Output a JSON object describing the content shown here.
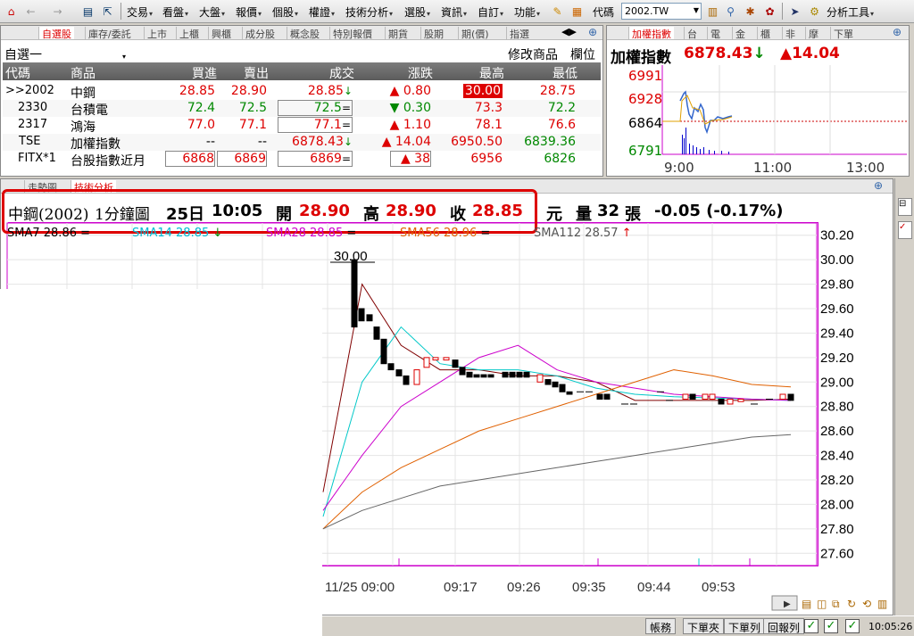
{
  "toolbar": {
    "menus": [
      "交易",
      "看盤",
      "大盤",
      "報價",
      "個股",
      "權證",
      "技術分析",
      "選股",
      "資訊",
      "自訂",
      "功能"
    ],
    "code_label": "代碼",
    "code_value": "2002.TW",
    "tools_label": "分析工具"
  },
  "watchlist": {
    "tabs": [
      "自選股",
      "庫存/委託",
      "上市",
      "上櫃",
      "興櫃",
      "成分股",
      "概念股",
      "特別報價",
      "期貨",
      "股期",
      "期(價)",
      "指選"
    ],
    "group_name": "自選一",
    "edit_label": "修改商品",
    "field_label": "欄位",
    "columns": [
      "代碼",
      "商品",
      "買進",
      "賣出",
      "成交",
      "漲跌",
      "最高",
      "最低"
    ],
    "rows": [
      {
        "code": ">>2002",
        "name": "中鋼",
        "bid": "28.85",
        "ask": "28.90",
        "last": "28.85",
        "last_mark": "↓",
        "chg": "0.80",
        "chg_dir": "▲",
        "high": "30.00",
        "low": "28.75"
      },
      {
        "code": "2330",
        "name": "台積電",
        "bid": "72.4",
        "ask": "72.5",
        "last": "72.5",
        "last_mark": "=",
        "chg": "0.30",
        "chg_dir": "▼",
        "high": "73.3",
        "low": "72.2"
      },
      {
        "code": "2317",
        "name": "鴻海",
        "bid": "77.0",
        "ask": "77.1",
        "last": "77.1",
        "last_mark": "=",
        "chg": "1.10",
        "chg_dir": "▲",
        "high": "78.1",
        "low": "76.6"
      },
      {
        "code": "TSE",
        "name": "加權指數",
        "bid": "--",
        "ask": "--",
        "last": "6878.43",
        "last_mark": "↓",
        "chg": "14.04",
        "chg_dir": "▲",
        "high": "6950.50",
        "low": "6839.36"
      },
      {
        "code": "FITX*1",
        "name": "台股指數近月",
        "bid": "6868",
        "ask": "6869",
        "last": "6869",
        "last_mark": "=",
        "chg": "38",
        "chg_dir": "▲",
        "high": "6956",
        "low": "6826"
      }
    ]
  },
  "index_panel": {
    "tabs": [
      "加權指數",
      "台",
      "電",
      "金",
      "櫃",
      "非",
      "摩",
      "下單"
    ],
    "title": "加權指數",
    "value": "6878.43",
    "value_mark": "↓",
    "change": "▲14.04",
    "y_labels": [
      "6991",
      "6928",
      "6864",
      "6791"
    ],
    "x_labels": [
      "9:00",
      "11:00",
      "13:00"
    ]
  },
  "chart": {
    "tabs": [
      "走勢圖",
      "技術分析"
    ],
    "info": {
      "name": "中鋼(2002)",
      "period": "1分鐘圖",
      "date": "25日",
      "time": "10:05",
      "open_label": "開",
      "open": "28.90",
      "high_label": "高",
      "high": "28.90",
      "close_label": "收",
      "close": "28.85",
      "unit": "元",
      "vol_label": "量",
      "volume": "32",
      "vol_unit": "張",
      "change": "-0.05 (-0.17%)"
    },
    "smas": [
      {
        "label": "SMA7 28.86",
        "mark": "=",
        "color": "#000000"
      },
      {
        "label": "SMA14 28.85",
        "mark": "↓",
        "color": "#00bcd4"
      },
      {
        "label": "SMA28 28.85",
        "mark": "=",
        "color": "#cc00cc"
      },
      {
        "label": "SMA56 28.96",
        "mark": "=",
        "color": "#e06000"
      },
      {
        "label": "SMA112 28.57",
        "mark": "↑",
        "color": "#555555"
      }
    ],
    "peak_label": "30.00",
    "y_labels": [
      "30.20",
      "30.00",
      "29.80",
      "29.60",
      "29.40",
      "29.20",
      "29.00",
      "28.80",
      "28.60",
      "28.40",
      "28.20",
      "28.00",
      "27.80",
      "27.60"
    ],
    "x_labels": [
      "11/25 09:00",
      "09:17",
      "09:26",
      "09:35",
      "09:44",
      "09:53"
    ]
  },
  "chart_data": {
    "type": "line",
    "title": "中鋼(2002) 1分鐘圖",
    "xlabel": "",
    "ylabel": "",
    "ylim": [
      27.5,
      30.3
    ],
    "x_ticks": [
      "11/25 09:00",
      "09:17",
      "09:26",
      "09:35",
      "09:44",
      "09:53"
    ],
    "series": [
      {
        "name": "SMA7",
        "values": [
          28.1,
          29.8,
          29.3,
          29.1,
          29.1,
          29.05,
          29.05,
          29.0,
          28.85,
          28.85,
          28.85,
          28.85,
          28.86
        ]
      },
      {
        "name": "SMA14",
        "values": [
          27.9,
          29.0,
          29.45,
          29.15,
          29.1,
          29.1,
          29.05,
          28.95,
          28.9,
          28.88,
          28.87,
          28.86,
          28.85
        ]
      },
      {
        "name": "SMA28",
        "values": [
          27.95,
          28.4,
          28.8,
          29.0,
          29.2,
          29.3,
          29.1,
          29.0,
          28.95,
          28.9,
          28.88,
          28.86,
          28.85
        ]
      },
      {
        "name": "SMA56",
        "values": [
          27.8,
          28.1,
          28.3,
          28.45,
          28.6,
          28.7,
          28.8,
          28.9,
          29.0,
          29.1,
          29.05,
          28.98,
          28.96
        ]
      },
      {
        "name": "SMA112",
        "values": [
          27.8,
          27.95,
          28.05,
          28.15,
          28.2,
          28.25,
          28.3,
          28.35,
          28.4,
          28.45,
          28.5,
          28.55,
          28.57
        ]
      }
    ]
  },
  "statusbar": {
    "buttons": [
      "帳務",
      "下單夾",
      "下單列",
      "回報列"
    ],
    "time": "10:05:26"
  }
}
